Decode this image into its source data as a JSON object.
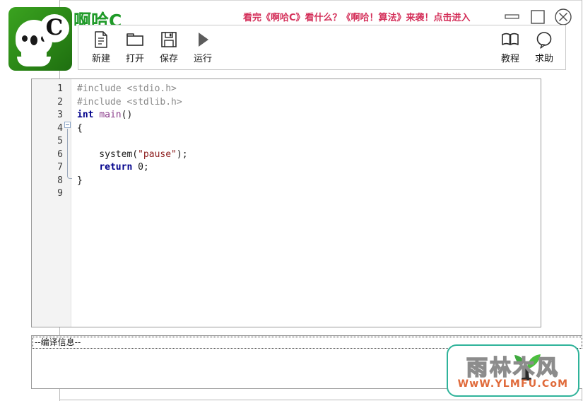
{
  "window": {
    "title": "啊哈C",
    "promo": "看完《啊哈C》看什么？《啊哈！算法》来袭！点击进入",
    "controls": {
      "minimize": "minimize",
      "maximize": "maximize",
      "close": "close"
    },
    "logo_letter": "C"
  },
  "toolbar": {
    "left": [
      {
        "id": "new",
        "label": "新建",
        "icon": "document-icon"
      },
      {
        "id": "open",
        "label": "打开",
        "icon": "folder-icon"
      },
      {
        "id": "save",
        "label": "保存",
        "icon": "floppy-disk-icon"
      },
      {
        "id": "run",
        "label": "运行",
        "icon": "play-icon"
      }
    ],
    "right": [
      {
        "id": "tutorial",
        "label": "教程",
        "icon": "book-icon"
      },
      {
        "id": "help",
        "label": "求助",
        "icon": "speech-bubble-icon"
      }
    ]
  },
  "editor": {
    "line_numbers": [
      "1",
      "2",
      "3",
      "4",
      "5",
      "6",
      "7",
      "8",
      "9"
    ],
    "lines": [
      {
        "n": "1",
        "tokens": [
          {
            "t": "#include <stdio.h>",
            "c": "tk-pre"
          }
        ]
      },
      {
        "n": "2",
        "tokens": [
          {
            "t": "#include <stdlib.h>",
            "c": "tk-pre"
          }
        ]
      },
      {
        "n": "3",
        "tokens": [
          {
            "t": "int ",
            "c": "tk-kw"
          },
          {
            "t": "main",
            "c": "tk-fn"
          },
          {
            "t": "()",
            "c": "tk-punc"
          }
        ]
      },
      {
        "n": "4",
        "tokens": [
          {
            "t": "{",
            "c": "tk-punc"
          }
        ]
      },
      {
        "n": "5",
        "tokens": []
      },
      {
        "n": "6",
        "tokens": [
          {
            "t": "    system(",
            "c": "tk-plain"
          },
          {
            "t": "\"pause\"",
            "c": "tk-str"
          },
          {
            "t": ");",
            "c": "tk-punc"
          }
        ]
      },
      {
        "n": "7",
        "tokens": [
          {
            "t": "    ",
            "c": "tk-plain"
          },
          {
            "t": "return",
            "c": "tk-kw"
          },
          {
            "t": " 0;",
            "c": "tk-plain"
          }
        ]
      },
      {
        "n": "8",
        "tokens": [
          {
            "t": "}",
            "c": "tk-punc"
          }
        ]
      },
      {
        "n": "9",
        "tokens": []
      }
    ],
    "code_plain": "#include <stdio.h>\n#include <stdlib.h>\nint main()\n{\n\n    system(\"pause\");\n    return 0;\n}\n"
  },
  "output": {
    "text": "--编译信息--"
  },
  "watermark": {
    "cn": "雨林木风",
    "url": "WwW.YLMFU.CoM"
  },
  "colors": {
    "brand_green": "#1f9a28",
    "promo_red": "#d4305a",
    "keyword_blue": "#00008b",
    "string_red": "#8b1a1a",
    "preproc_gray": "#8a8a8a",
    "watermark_teal": "#2fb39a",
    "watermark_orange": "#e06a3a"
  }
}
